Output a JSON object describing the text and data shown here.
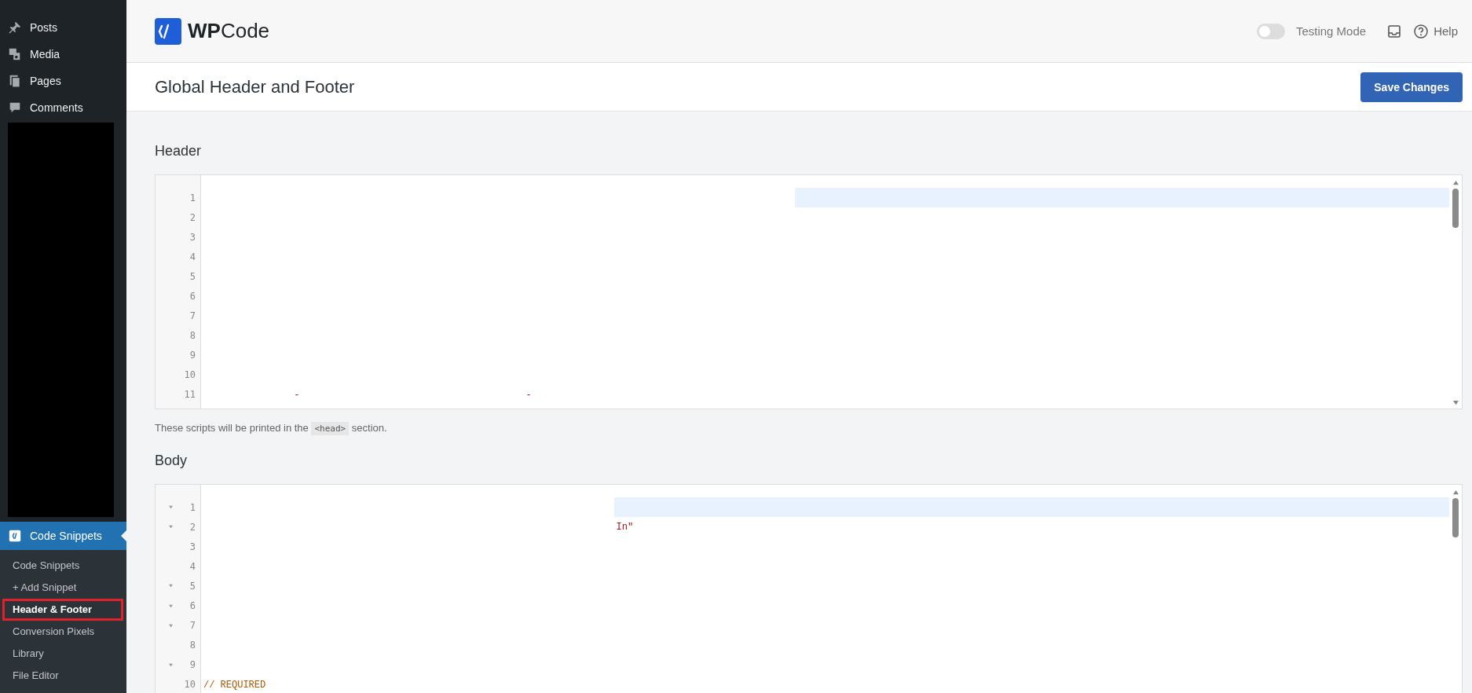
{
  "sidebar": {
    "items": [
      {
        "label": "Posts"
      },
      {
        "label": "Media"
      },
      {
        "label": "Pages"
      },
      {
        "label": "Comments"
      }
    ],
    "active_menu": {
      "label": "Code Snippets",
      "selected": true
    },
    "submenu": [
      {
        "label": "Code Snippets",
        "selected": false,
        "outlined": false
      },
      {
        "label": "+ Add Snippet",
        "selected": false,
        "outlined": false
      },
      {
        "label": "Header & Footer",
        "selected": true,
        "outlined": true
      },
      {
        "label": "Conversion Pixels",
        "selected": false,
        "outlined": false
      },
      {
        "label": "Library",
        "selected": false,
        "outlined": false
      },
      {
        "label": "File Editor",
        "selected": false,
        "outlined": false
      }
    ]
  },
  "topbar": {
    "logo": "**WP**Code",
    "testing_mode": {
      "label": "Testing Mode",
      "on": false
    },
    "help": "Help"
  },
  "page_title": "Global Header and Footer",
  "save_button": "Save Changes",
  "sections": [
    {
      "heading": "Header",
      "lines": [
        {
          "number": "1",
          "fold": false,
          "highlighted": true
        },
        {
          "number": "2",
          "fold": false,
          "highlighted": false
        },
        {
          "number": "3",
          "fold": false,
          "highlighted": false
        },
        {
          "number": "4",
          "fold": false,
          "highlighted": false
        },
        {
          "number": "5",
          "fold": false,
          "highlighted": false
        },
        {
          "number": "6",
          "fold": false,
          "highlighted": false
        },
        {
          "number": "7",
          "fold": false,
          "highlighted": false
        },
        {
          "number": "8",
          "fold": false,
          "highlighted": false
        },
        {
          "number": "9",
          "fold": false,
          "highlighted": false
        },
        {
          "number": "10",
          "fold": false,
          "highlighted": false
        },
        {
          "number": "11",
          "fold": false,
          "highlighted": false,
          "tokens": [
            {
              "text": "-",
              "kind": "string"
            },
            {
              "text": "-",
              "kind": "string"
            }
          ]
        }
      ],
      "help": {
        "before": "These scripts will be printed in the",
        "code": "<head>",
        "after": "section."
      }
    },
    {
      "heading": "Body",
      "lines": [
        {
          "number": "1",
          "fold": true,
          "highlighted": true
        },
        {
          "number": "2",
          "fold": true,
          "highlighted": false,
          "tokens": [
            {
              "text": "In\"",
              "kind": "string"
            }
          ]
        },
        {
          "number": "3",
          "fold": false,
          "highlighted": false
        },
        {
          "number": "4",
          "fold": false,
          "highlighted": false
        },
        {
          "number": "5",
          "fold": true,
          "highlighted": false
        },
        {
          "number": "6",
          "fold": true,
          "highlighted": false
        },
        {
          "number": "7",
          "fold": true,
          "highlighted": false
        },
        {
          "number": "8",
          "fold": false,
          "highlighted": false
        },
        {
          "number": "9",
          "fold": true,
          "highlighted": false
        },
        {
          "number": "10",
          "fold": false,
          "highlighted": false,
          "tokens": [
            {
              "text": "// REQUIRED",
              "kind": "comment"
            }
          ]
        }
      ]
    }
  ]
}
